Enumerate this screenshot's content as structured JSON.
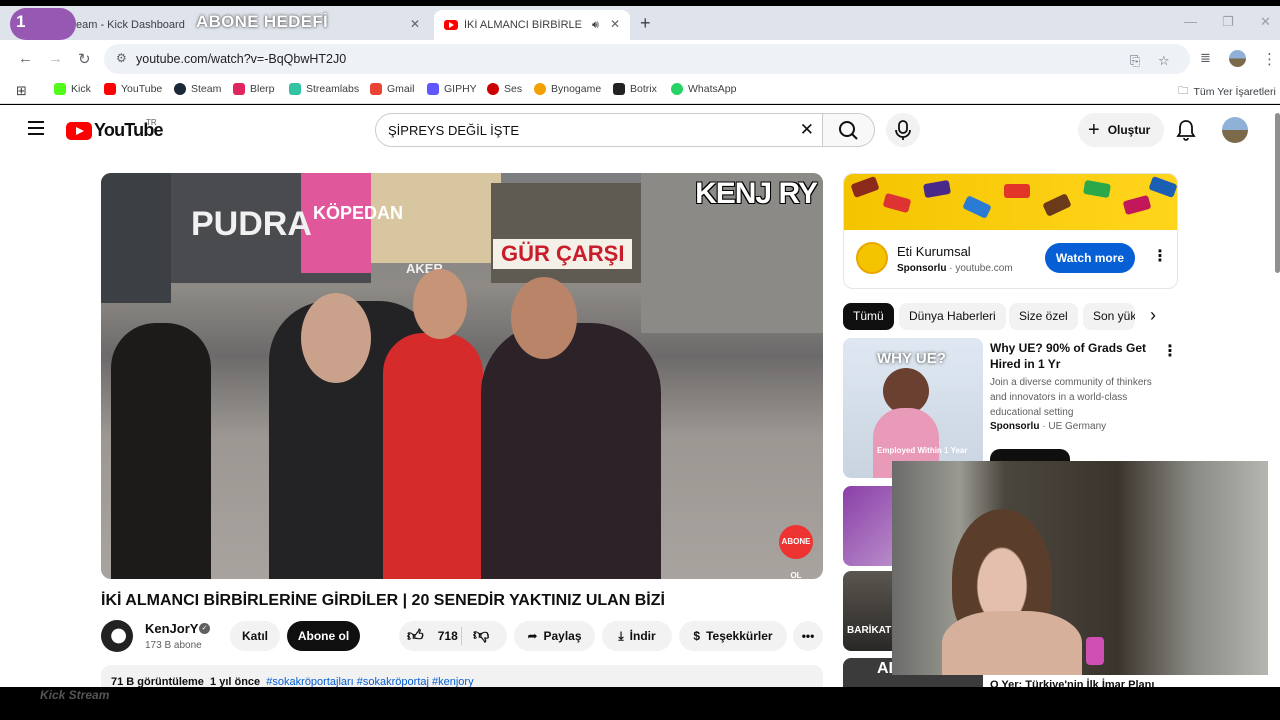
{
  "overlay": {
    "number": "1",
    "title": "ABONE HEDEFİ"
  },
  "tabs": [
    {
      "title": "eam - Kick Dashboard",
      "active": false
    },
    {
      "title": "İKİ ALMANCI BİRBİRLERİNE",
      "active": true
    }
  ],
  "toolbar": {
    "url": "youtube.com/watch?v=-BqQbwHT2J0"
  },
  "bookmarks": [
    {
      "label": "Kick",
      "color": "#53fc18"
    },
    {
      "label": "YouTube",
      "color": "#ff0000"
    },
    {
      "label": "Steam",
      "color": "#1b2838"
    },
    {
      "label": "Blerp",
      "color": "#e0245e"
    },
    {
      "label": "Streamlabs",
      "color": "#31c3a2"
    },
    {
      "label": "Gmail",
      "color": "#ea4335"
    },
    {
      "label": "GIPHY",
      "color": "#6157ff"
    },
    {
      "label": "Ses",
      "color": "#c00"
    },
    {
      "label": "Bynogame",
      "color": "#f2a100"
    },
    {
      "label": "Botrix",
      "color": "#222"
    },
    {
      "label": "WhatsApp",
      "color": "#25d366"
    }
  ],
  "bookmarks_all": "Tüm Yer İşaretleri",
  "youtube": {
    "logo": "YouTube",
    "country": "TR",
    "search_value": "ŞİPREYS DEĞİL İŞTE",
    "create_label": "Oluştur"
  },
  "video": {
    "title": "İKİ ALMANCI BİRBİRLERİNE GİRDİLER | 20 SENEDİR YAKTINIZ ULAN BİZİ",
    "channel": "KenJorY",
    "subscribers": "173 B abone",
    "join_label": "Katıl",
    "subscribe_label": "Abone ol",
    "likes": "718",
    "share_label": "Paylaş",
    "download_label": "İndir",
    "thanks_label": "Teşekkürler",
    "views": "71 B görüntüleme",
    "age": "1 yıl önce",
    "tags": "#sokakröportajları #sokakröportaj #kenjory",
    "brand_mark": "KENJ RY",
    "abone_mark": "ABONE OL",
    "signs": {
      "pudra": "PUDRA",
      "kopedan": "KÖPEDAN",
      "aker": "AKER",
      "gur": "GÜR ÇARŞI"
    }
  },
  "ad": {
    "name": "Eti Kurumsal",
    "sponsored": "Sponsorlu",
    "domain": "youtube.com",
    "watch_label": "Watch more"
  },
  "chips": [
    "Tümü",
    "Dünya Haberleri",
    "Size özel",
    "Son yük"
  ],
  "recommended": {
    "title": "Why UE? 90% of Grads Get Hired in 1 Yr",
    "desc": "Join a diverse community of thinkers and innovators in a world-class educational setting",
    "sponsored": "Sponsorlu",
    "advertiser": "UE Germany",
    "thumb_caption": "WHY UE?",
    "thumb_sub": "Employed Within 1 Year",
    "thumb2_text": "BARİKAT DİĞER TAR",
    "thumb3_text": "AL"
  },
  "bottom_text": "O Yer: Türkiye'nin İlk İmar Planı",
  "watermark": "Kick Stream"
}
